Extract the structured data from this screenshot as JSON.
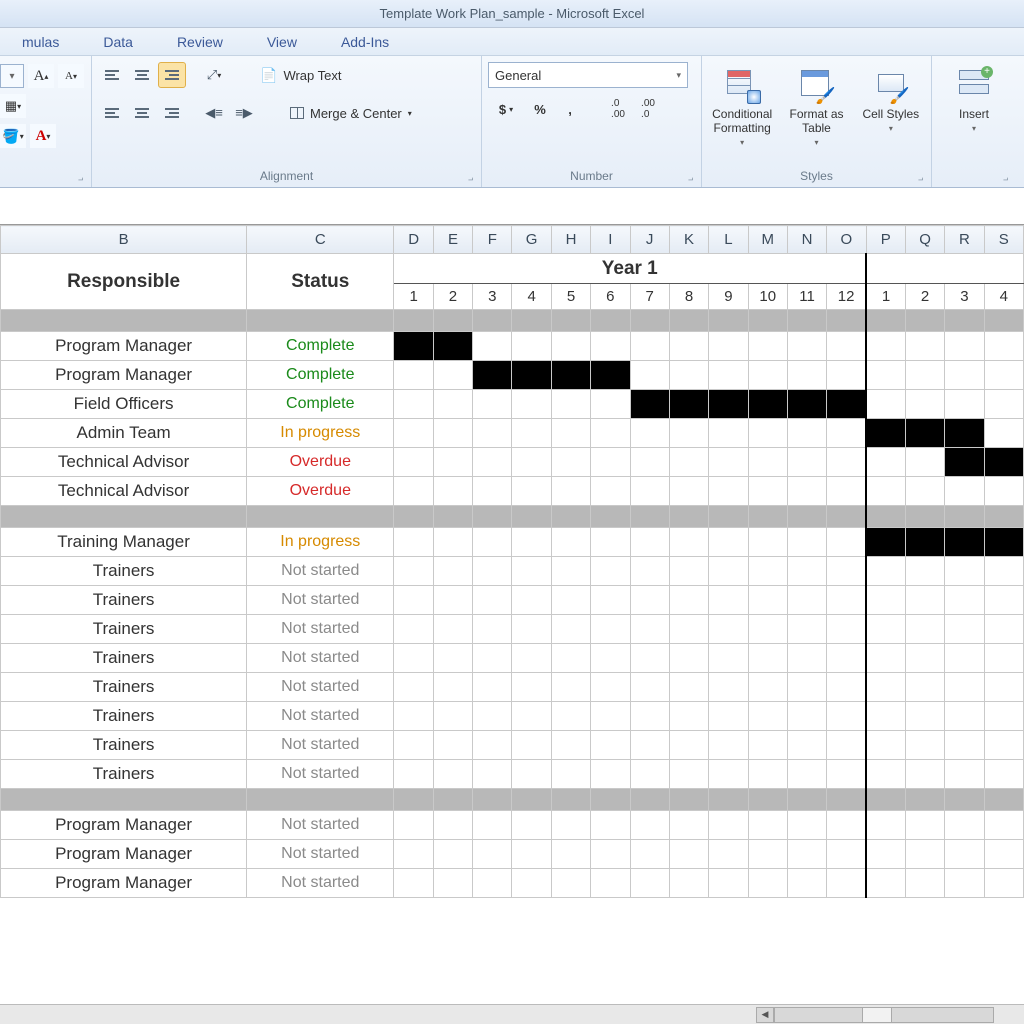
{
  "app": {
    "title": "Template Work Plan_sample  -  Microsoft Excel"
  },
  "ribbon_tabs": [
    "mulas",
    "Data",
    "Review",
    "View",
    "Add-Ins"
  ],
  "ribbon": {
    "font_group_label": "",
    "alignment_label": "Alignment",
    "wrap_text": "Wrap Text",
    "merge_center": "Merge & Center",
    "number_label": "Number",
    "number_format": "General",
    "styles_label": "Styles",
    "cond_fmt": "Conditional Formatting",
    "fmt_table": "Format as Table",
    "cell_styles": "Cell Styles",
    "insert": "Insert"
  },
  "columns": [
    "B",
    "C",
    "D",
    "E",
    "F",
    "G",
    "H",
    "I",
    "J",
    "K",
    "L",
    "M",
    "N",
    "O",
    "P",
    "Q",
    "R",
    "S"
  ],
  "headers": {
    "responsible": "Responsible",
    "status": "Status",
    "year1": "Year 1"
  },
  "months_yr1": [
    "1",
    "2",
    "3",
    "4",
    "5",
    "6",
    "7",
    "8",
    "9",
    "10",
    "11",
    "12"
  ],
  "months_yr2": [
    "1",
    "2",
    "3",
    "4"
  ],
  "rows": [
    {
      "type": "separator"
    },
    {
      "type": "data",
      "responsible": "Program Manager",
      "status": "Complete",
      "status_class": "complete",
      "fill": [
        0,
        1
      ]
    },
    {
      "type": "data",
      "responsible": "Program Manager",
      "status": "Complete",
      "status_class": "complete",
      "fill": [
        2,
        3,
        4,
        5
      ]
    },
    {
      "type": "data",
      "responsible": "Field Officers",
      "status": "Complete",
      "status_class": "complete",
      "fill": [
        6,
        7,
        8,
        9,
        10,
        11
      ]
    },
    {
      "type": "data",
      "responsible": "Admin Team",
      "status": "In progress",
      "status_class": "inprogress",
      "fill": [
        12,
        13,
        14
      ]
    },
    {
      "type": "data",
      "responsible": "Technical Advisor",
      "status": "Overdue",
      "status_class": "overdue",
      "fill": [
        14,
        15
      ]
    },
    {
      "type": "data",
      "responsible": "Technical Advisor",
      "status": "Overdue",
      "status_class": "overdue",
      "fill": []
    },
    {
      "type": "separator"
    },
    {
      "type": "data",
      "responsible": "Training Manager",
      "status": "In progress",
      "status_class": "inprogress",
      "fill": [
        12,
        13,
        14,
        15
      ]
    },
    {
      "type": "data",
      "responsible": "Trainers",
      "status": "Not started",
      "status_class": "notstarted",
      "fill": []
    },
    {
      "type": "data",
      "responsible": "Trainers",
      "status": "Not started",
      "status_class": "notstarted",
      "fill": []
    },
    {
      "type": "data",
      "responsible": "Trainers",
      "status": "Not started",
      "status_class": "notstarted",
      "fill": []
    },
    {
      "type": "data",
      "responsible": "Trainers",
      "status": "Not started",
      "status_class": "notstarted",
      "fill": []
    },
    {
      "type": "data",
      "responsible": "Trainers",
      "status": "Not started",
      "status_class": "notstarted",
      "fill": []
    },
    {
      "type": "data",
      "responsible": "Trainers",
      "status": "Not started",
      "status_class": "notstarted",
      "fill": []
    },
    {
      "type": "data",
      "responsible": "Trainers",
      "status": "Not started",
      "status_class": "notstarted",
      "fill": []
    },
    {
      "type": "data",
      "responsible": "Trainers",
      "status": "Not started",
      "status_class": "notstarted",
      "fill": []
    },
    {
      "type": "separator"
    },
    {
      "type": "data",
      "responsible": "Program Manager",
      "status": "Not started",
      "status_class": "notstarted",
      "fill": []
    },
    {
      "type": "data",
      "responsible": "Program Manager",
      "status": "Not started",
      "status_class": "notstarted",
      "fill": []
    },
    {
      "type": "data",
      "responsible": "Program Manager",
      "status": "Not started",
      "status_class": "notstarted",
      "fill": []
    }
  ]
}
